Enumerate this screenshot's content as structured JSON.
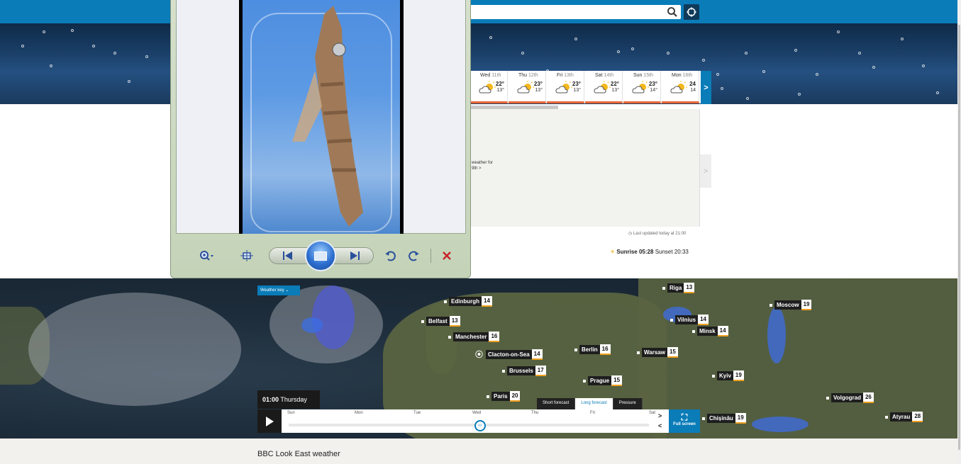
{
  "forecast": {
    "days": [
      {
        "name": "Wed",
        "date": "11th",
        "high": "22°",
        "low": "13°"
      },
      {
        "name": "Thu",
        "date": "12th",
        "high": "23°",
        "low": "13°"
      },
      {
        "name": "Fri",
        "date": "13th",
        "high": "23°",
        "low": "13°"
      },
      {
        "name": "Sat",
        "date": "14th",
        "high": "22°",
        "low": "13°"
      },
      {
        "name": "Sun",
        "date": "15th",
        "high": "23°",
        "low": "14°"
      },
      {
        "name": "Mon",
        "date": "16th",
        "high": "24",
        "low": "14"
      }
    ],
    "partial_day_high": "°",
    "next_label": ">",
    "side_label": ">",
    "weather_link_line1": "weather for",
    "weather_link_line2": "9th >",
    "last_updated": "Last updated today at 21:00",
    "sunrise_label": "Sunrise",
    "sunrise_time": "05:28",
    "sunset_label": "Sunset",
    "sunset_time": "20:33"
  },
  "map": {
    "weather_key": "Weather key",
    "time_label": "01:00",
    "day_label": "Thursday",
    "tabs": [
      "Short forecast",
      "Long forecast",
      "Pressure"
    ],
    "active_tab": "Long forecast",
    "timeline_days": [
      "Sun",
      "Mon",
      "Tue",
      "Wed",
      "Thu",
      "Fri",
      "Sat"
    ],
    "next_arrow": ">",
    "prev_arrow": "<",
    "fullscreen_label": "Full screen",
    "cities": [
      {
        "name": "Edinburgh",
        "temp": "14"
      },
      {
        "name": "Belfast",
        "temp": "13"
      },
      {
        "name": "Manchester",
        "temp": "16"
      },
      {
        "name": "Clacton-on-Sea",
        "temp": "14"
      },
      {
        "name": "Brussels",
        "temp": "17"
      },
      {
        "name": "Paris",
        "temp": "20"
      },
      {
        "name": "Berlin",
        "temp": "16"
      },
      {
        "name": "Prague",
        "temp": "15"
      },
      {
        "name": "Warsaw",
        "temp": "15"
      },
      {
        "name": "Riga",
        "temp": "13"
      },
      {
        "name": "Vilnius",
        "temp": "14"
      },
      {
        "name": "Minsk",
        "temp": "14"
      },
      {
        "name": "Moscow",
        "temp": "19"
      },
      {
        "name": "Kyiv",
        "temp": "19"
      },
      {
        "name": "Volgograd",
        "temp": "26"
      },
      {
        "name": "Chișinău",
        "temp": "19"
      },
      {
        "name": "Atyrau",
        "temp": "28"
      }
    ]
  },
  "footer": {
    "title": "BBC Look East weather"
  },
  "colors": {
    "accent": "#0a7cb8",
    "warm_underline": "#e8683a"
  }
}
